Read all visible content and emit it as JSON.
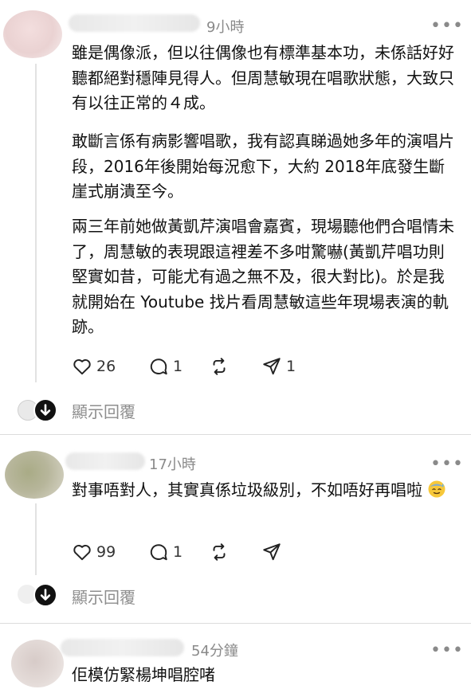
{
  "posts": [
    {
      "time": "9小時",
      "paragraphs": [
        "雖是偶像派，但以往偶像也有標準基本功，未係話好好聽都絕對穩陣見得人。但周慧敏現在唱歌狀態，大致只有以往正常的４成。",
        "敢斷言係有病影響唱歌，我有認真睇過她多年的演唱片段，2016年後開始每況愈下，大約 2018年底發生斷崖式崩潰至今。",
        "兩三年前她做黃凱芹演唱會嘉賓，現場聽他們合唱情未了，周慧敏的表現跟這裡差不多咁驚嚇(黃凱芹唱功則堅實如昔，可能尤有過之無不及，很大對比)。於是我就開始在 Youtube 找片看周慧敏這些年現場表演的軌跡。"
      ],
      "likes": "26",
      "comments": "1",
      "shares": "1",
      "replies_label": "顯示回覆"
    },
    {
      "time": "17小時",
      "paragraphs": [
        "對事唔對人，其實真係垃圾級別，不如唔好再唱啦"
      ],
      "likes": "99",
      "comments": "1",
      "replies_label": "顯示回覆"
    },
    {
      "time": "54分鐘",
      "paragraphs": [
        "佢模仿緊楊坤唱腔啫"
      ]
    }
  ]
}
